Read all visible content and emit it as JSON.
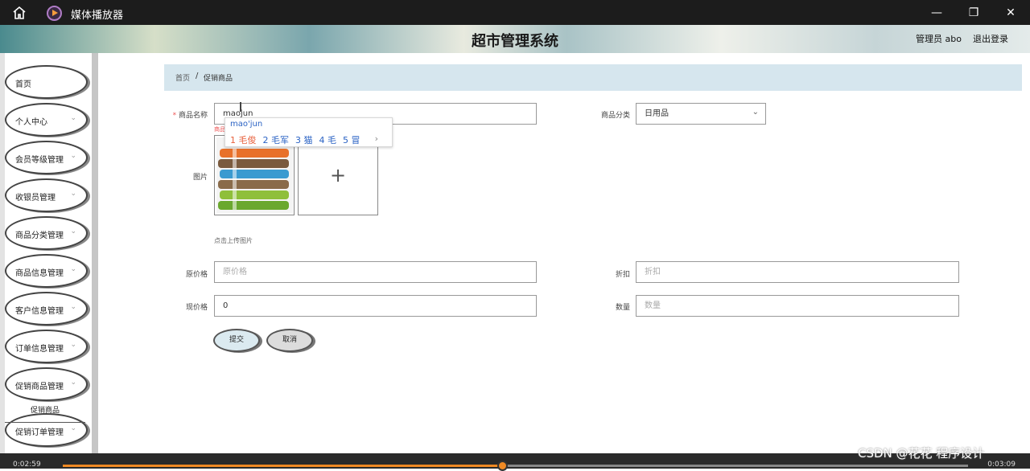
{
  "titlebar": {
    "title": "媒体播放器",
    "controls": {
      "minimize": "—",
      "restore": "❐",
      "close": "✕"
    }
  },
  "header": {
    "system_title": "超市管理系统",
    "admin": "管理员 abo",
    "logout": "退出登录"
  },
  "sidebar": {
    "items": [
      {
        "label": "首页",
        "chevron": false
      },
      {
        "label": "个人中心",
        "chevron": true
      },
      {
        "label": "会员等级管理",
        "chevron": true
      },
      {
        "label": "收银员管理",
        "chevron": true
      },
      {
        "label": "商品分类管理",
        "chevron": true
      },
      {
        "label": "商品信息管理",
        "chevron": true
      },
      {
        "label": "客户信息管理",
        "chevron": true
      },
      {
        "label": "订单信息管理",
        "chevron": true
      },
      {
        "label": "促销商品管理",
        "chevron": true
      },
      {
        "label": "促销订单管理",
        "chevron": true
      }
    ],
    "submenu": "促销商品",
    "chevron_glyph": "⌄"
  },
  "breadcrumb": {
    "home": "首页",
    "separator": "/",
    "current": "促销商品"
  },
  "form": {
    "product_name": {
      "label": "商品名称",
      "required_mark": "*",
      "value": "maojun",
      "error": "商品"
    },
    "category": {
      "label": "商品分类",
      "value": "日用品"
    },
    "image": {
      "label": "图片",
      "hint": "点击上传图片",
      "plus": "+"
    },
    "original_price": {
      "label": "原价格",
      "placeholder": "原价格"
    },
    "discount": {
      "label": "折扣",
      "placeholder": "折扣"
    },
    "current_price": {
      "label": "现价格",
      "value": "0"
    },
    "quantity": {
      "label": "数量",
      "placeholder": "数量"
    },
    "submit": "提交",
    "cancel": "取消"
  },
  "ime": {
    "composition": "mao'jun",
    "candidates": [
      "1 毛俊",
      "2 毛军",
      "3 猫",
      "4 毛",
      "5 冒"
    ],
    "next": "›"
  },
  "player": {
    "elapsed": "0:02:59",
    "total": "0:03:09",
    "progress": 0.485
  },
  "watermark": "CSDN @花花 程序设计",
  "colors": {
    "progress": "#f08a24",
    "breadcrumb_bg": "#d6e6ee",
    "submit_bg": "#dbeaf0",
    "cancel_bg": "#dcdcdc"
  }
}
